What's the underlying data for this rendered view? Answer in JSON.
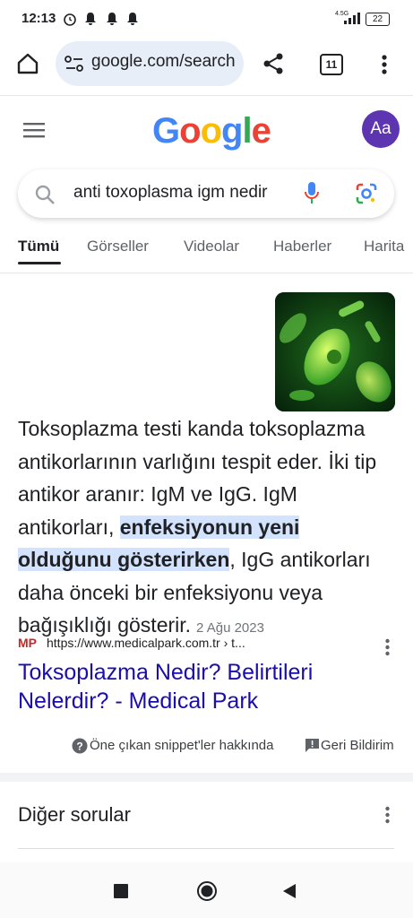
{
  "status_bar": {
    "time": "12:13",
    "network": "4.5G",
    "battery": "22"
  },
  "browser": {
    "url": "google.com/search",
    "tab_count": "11"
  },
  "google": {
    "logo": [
      "G",
      "o",
      "o",
      "g",
      "l",
      "e"
    ],
    "logo_colors": [
      "#4285F4",
      "#EA4335",
      "#FBBC05",
      "#4285F4",
      "#34A853",
      "#EA4335"
    ],
    "avatar_initials": "Aa",
    "search_value": "anti toxoplasma igm nedir",
    "tabs": [
      "Tümü",
      "Görseller",
      "Videolar",
      "Haberler",
      "Harita"
    ]
  },
  "snippet": {
    "text_before": "Toksoplazma testi kanda toksoplazma antikorlarının varlığını tespit eder. İki tip antikor aranır: IgM ve IgG. IgM antikorları, ",
    "highlight": "enfeksiyonun yeni olduğunu gösterirken",
    "text_after": ", IgG antikorları daha önceki bir enfeksiyonu veya bağışıklığı gösterir.",
    "date": "2 Ağu 2023",
    "source_logo": "MP",
    "source_url": "https://www.medicalpark.com.tr › t...",
    "result_title": "Toksoplazma Nedir? Belirtileri Nelerdir? - Medical Park",
    "about_label": "Öne çıkan snippet'ler hakkında",
    "feedback_label": "Geri Bildirim"
  },
  "more_questions": {
    "title": "Diğer sorular"
  }
}
